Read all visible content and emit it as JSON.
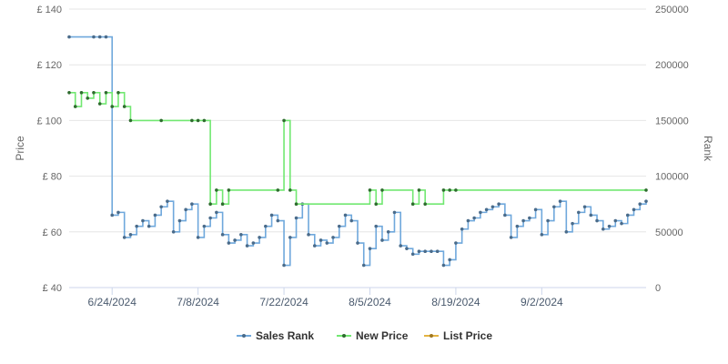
{
  "chart_data": {
    "type": "line",
    "ylabel_left": "Price",
    "ylabel_right": "Rank",
    "ylim_left": [
      40,
      140
    ],
    "ylim_right": [
      0,
      250000
    ],
    "yticks_left": [
      "£ 40",
      "£ 60",
      "£ 80",
      "£ 100",
      "£ 120",
      "£ 140"
    ],
    "yticks_left_values": [
      40,
      60,
      80,
      100,
      120,
      140
    ],
    "yticks_right": [
      "0",
      "50000",
      "100000",
      "150000",
      "200000",
      "250000"
    ],
    "yticks_right_values": [
      0,
      50000,
      100000,
      150000,
      200000,
      250000
    ],
    "xlim": [
      "2024-06-17",
      "2024-09-19"
    ],
    "xticks": [
      "6/24/2024",
      "7/8/2024",
      "7/22/2024",
      "8/5/2024",
      "8/19/2024",
      "9/2/2024"
    ],
    "xticks_dates": [
      "2024-06-24",
      "2024-07-08",
      "2024-07-22",
      "2024-08-05",
      "2024-08-19",
      "2024-09-02"
    ],
    "grid": true,
    "legend_position": "bottom",
    "series": [
      {
        "name": "Sales Rank",
        "axis": "right",
        "color": "#6fa8dc",
        "marker_color": "#4a6b8a",
        "x": [
          "2024-06-17",
          "2024-06-21",
          "2024-06-22",
          "2024-06-23",
          "2024-06-24",
          "2024-06-25",
          "2024-06-26",
          "2024-06-27",
          "2024-06-28",
          "2024-06-29",
          "2024-06-30",
          "2024-07-01",
          "2024-07-02",
          "2024-07-03",
          "2024-07-04",
          "2024-07-05",
          "2024-07-06",
          "2024-07-07",
          "2024-07-08",
          "2024-07-09",
          "2024-07-10",
          "2024-07-11",
          "2024-07-12",
          "2024-07-13",
          "2024-07-14",
          "2024-07-15",
          "2024-07-16",
          "2024-07-17",
          "2024-07-18",
          "2024-07-19",
          "2024-07-20",
          "2024-07-21",
          "2024-07-22",
          "2024-07-23",
          "2024-07-24",
          "2024-07-25",
          "2024-07-26",
          "2024-07-27",
          "2024-07-28",
          "2024-07-29",
          "2024-07-30",
          "2024-07-31",
          "2024-08-01",
          "2024-08-02",
          "2024-08-03",
          "2024-08-04",
          "2024-08-05",
          "2024-08-06",
          "2024-08-07",
          "2024-08-08",
          "2024-08-09",
          "2024-08-10",
          "2024-08-11",
          "2024-08-12",
          "2024-08-13",
          "2024-08-14",
          "2024-08-15",
          "2024-08-16",
          "2024-08-17",
          "2024-08-18",
          "2024-08-19",
          "2024-08-20",
          "2024-08-21",
          "2024-08-22",
          "2024-08-23",
          "2024-08-24",
          "2024-08-25",
          "2024-08-26",
          "2024-08-27",
          "2024-08-28",
          "2024-08-29",
          "2024-08-30",
          "2024-08-31",
          "2024-09-01",
          "2024-09-02",
          "2024-09-03",
          "2024-09-04",
          "2024-09-05",
          "2024-09-06",
          "2024-09-07",
          "2024-09-08",
          "2024-09-09",
          "2024-09-10",
          "2024-09-11",
          "2024-09-12",
          "2024-09-13",
          "2024-09-14",
          "2024-09-15",
          "2024-09-16",
          "2024-09-17",
          "2024-09-18",
          "2024-09-19"
        ],
        "values": [
          225000,
          225000,
          225000,
          225000,
          65000,
          67500,
          45000,
          47500,
          55000,
          60000,
          55000,
          65000,
          72500,
          77500,
          50000,
          60000,
          70000,
          75000,
          45000,
          55000,
          62500,
          67500,
          47500,
          40000,
          42500,
          47500,
          37500,
          40000,
          45000,
          55000,
          65000,
          60000,
          20000,
          45000,
          62500,
          75000,
          47500,
          37500,
          42500,
          40000,
          45000,
          55000,
          65000,
          60000,
          40000,
          20000,
          35000,
          55000,
          42500,
          50000,
          67500,
          37500,
          35000,
          30000,
          32500,
          32500,
          32500,
          32500,
          20000,
          25000,
          40000,
          52500,
          60000,
          62500,
          67500,
          70000,
          72500,
          75000,
          65000,
          45000,
          55000,
          60000,
          62500,
          70000,
          47500,
          60000,
          72500,
          77500,
          50000,
          57500,
          67500,
          72500,
          65000,
          60000,
          52500,
          55000,
          60000,
          57500,
          65000,
          70000,
          75000,
          77500
        ]
      },
      {
        "name": "New Price",
        "axis": "left",
        "color": "#72e872",
        "marker_color": "#2e6b2e",
        "x": [
          "2024-06-17",
          "2024-06-18",
          "2024-06-19",
          "2024-06-20",
          "2024-06-21",
          "2024-06-22",
          "2024-06-23",
          "2024-06-24",
          "2024-06-25",
          "2024-06-26",
          "2024-06-27",
          "2024-07-02",
          "2024-07-07",
          "2024-07-08",
          "2024-07-09",
          "2024-07-10",
          "2024-07-11",
          "2024-07-12",
          "2024-07-13",
          "2024-07-21",
          "2024-07-22",
          "2024-07-23",
          "2024-07-24",
          "2024-08-05",
          "2024-08-06",
          "2024-08-07",
          "2024-08-12",
          "2024-08-13",
          "2024-08-14",
          "2024-08-17",
          "2024-08-18",
          "2024-08-19",
          "2024-09-19"
        ],
        "values": [
          110,
          105,
          110,
          108,
          110,
          106,
          110,
          105,
          110,
          105,
          100,
          100,
          100,
          100,
          100,
          70,
          75,
          70,
          75,
          75,
          100,
          75,
          70,
          75,
          70,
          75,
          70,
          75,
          70,
          75,
          75,
          75,
          75
        ]
      },
      {
        "name": "List Price",
        "axis": "left",
        "color": "#e3b341",
        "marker_color": "#a07820",
        "x": [],
        "values": []
      }
    ]
  }
}
